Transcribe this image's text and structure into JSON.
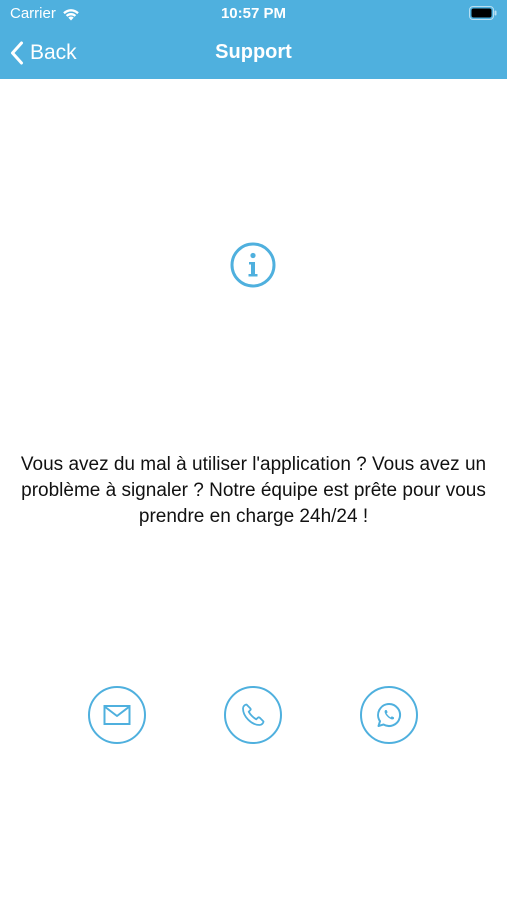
{
  "status_bar": {
    "carrier": "Carrier",
    "time": "10:57 PM",
    "wifi_icon": "wifi-icon",
    "battery_icon": "battery-icon"
  },
  "nav": {
    "back_label": "Back",
    "back_icon": "chevron-left-icon",
    "title": "Support"
  },
  "content": {
    "info_icon": "info-icon",
    "message": "Vous avez du mal à utiliser l'application ? Vous avez un problème à signaler ? Notre équipe est prête pour vous prendre en charge 24h/24 !"
  },
  "actions": [
    {
      "icon": "envelope-icon"
    },
    {
      "icon": "phone-icon"
    },
    {
      "icon": "whatsapp-icon"
    }
  ],
  "colors": {
    "accent": "#4FB0DE",
    "background": "#FFFFFF",
    "text": "#111111"
  }
}
